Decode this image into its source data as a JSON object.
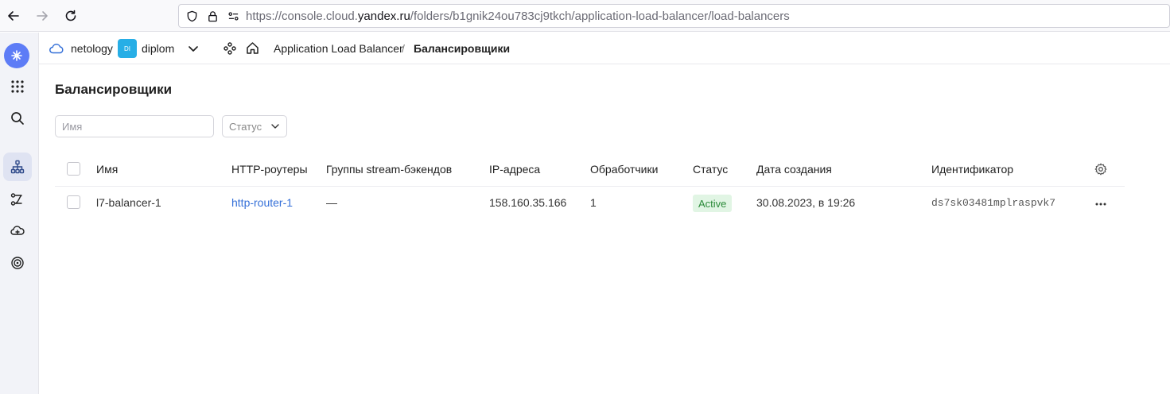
{
  "browser": {
    "url_prefix": "https://console.cloud.",
    "url_host": "yandex.ru",
    "url_path": "/folders/b1gnik24ou783cj9tkch/application-load-balancer/load-balancers"
  },
  "header": {
    "org": "netology",
    "folder_badge": "DI",
    "folder": "diplom",
    "breadcrumb_service": "Application Load Balancer",
    "breadcrumb_sep": "/",
    "breadcrumb_page": "Балансировщики"
  },
  "main": {
    "title": "Балансировщики",
    "filter_name_placeholder": "Имя",
    "filter_status_label": "Статус"
  },
  "table": {
    "columns": [
      "Имя",
      "HTTP-роутеры",
      "Группы stream-бэкендов",
      "IP-адреса",
      "Обработчики",
      "Статус",
      "Дата создания",
      "Идентификатор"
    ],
    "rows": [
      {
        "name": "l7-balancer-1",
        "http_routers": "http-router-1",
        "stream_groups": "—",
        "ip": "158.160.35.166",
        "listeners": "1",
        "status": "Active",
        "created": "30.08.2023, в 19:26",
        "id": "ds7sk03481mplraspvk7"
      }
    ]
  },
  "colors": {
    "accent": "#5d7cf6",
    "link": "#3570d8",
    "status_active_bg": "#e1f5e4",
    "status_active_text": "#2d8b3b",
    "folder_badge": "#27aee6"
  }
}
